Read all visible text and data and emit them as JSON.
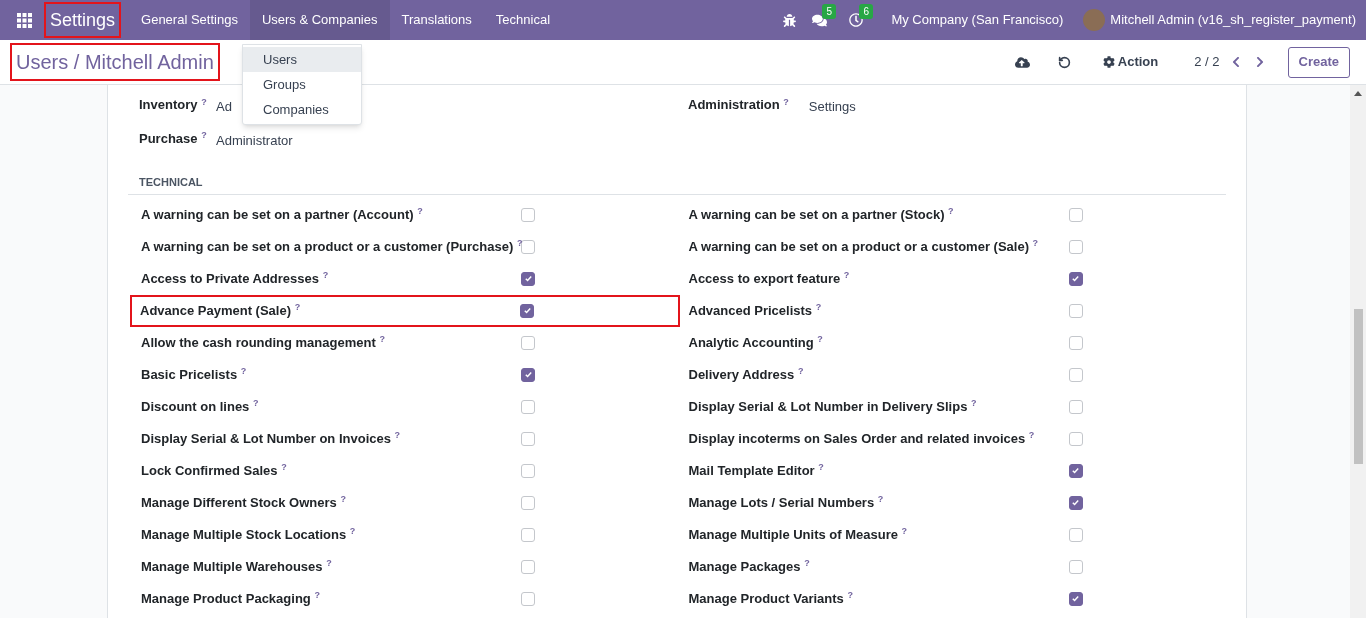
{
  "navbar": {
    "app": {
      "label": "Settings",
      "highlighted": true
    },
    "menus": [
      {
        "label": "General Settings",
        "selected": false
      },
      {
        "label": "Users & Companies",
        "selected": true
      },
      {
        "label": "Translations",
        "selected": false
      },
      {
        "label": "Technical",
        "selected": false
      }
    ],
    "messages_badge": "5",
    "activities_badge": "6",
    "company": "My Company (San Francisco)",
    "user": "Mitchell Admin (v16_sh_register_payment)"
  },
  "dropdown": [
    {
      "label": "Users",
      "selected": true
    },
    {
      "label": "Groups",
      "selected": false
    },
    {
      "label": "Companies",
      "selected": false
    }
  ],
  "breadcrumb": {
    "text": "Users / Mitchell Admin",
    "highlighted": true
  },
  "control_panel": {
    "action": "Action",
    "pager": "2 / 2",
    "create": "Create"
  },
  "access_rights": [
    {
      "label": "Inventory",
      "help": "?",
      "value": "Ad"
    },
    {
      "label": "Administration",
      "help": "?",
      "value": "Settings"
    },
    {
      "label": "Purchase",
      "help": "?",
      "value": "Administrator"
    }
  ],
  "section": "TECHNICAL",
  "settings": [
    {
      "label": "A warning can be set on a partner (Account)",
      "help": "?",
      "checked": false,
      "highlighted": false
    },
    {
      "label": "A warning can be set on a partner (Stock)",
      "help": "?",
      "checked": false,
      "highlighted": false
    },
    {
      "label": "A warning can be set on a product or a customer (Purchase)",
      "help": "?",
      "checked": false,
      "highlighted": false
    },
    {
      "label": "A warning can be set on a product or a customer (Sale)",
      "help": "?",
      "checked": false,
      "highlighted": false
    },
    {
      "label": "Access to Private Addresses",
      "help": "?",
      "checked": true,
      "highlighted": false
    },
    {
      "label": "Access to export feature",
      "help": "?",
      "checked": true,
      "highlighted": false
    },
    {
      "label": "Advance Payment (Sale)",
      "help": "?",
      "checked": true,
      "highlighted": true
    },
    {
      "label": "Advanced Pricelists",
      "help": "?",
      "checked": false,
      "highlighted": false
    },
    {
      "label": "Allow the cash rounding management",
      "help": "?",
      "checked": false,
      "highlighted": false
    },
    {
      "label": "Analytic Accounting",
      "help": "?",
      "checked": false,
      "highlighted": false
    },
    {
      "label": "Basic Pricelists",
      "help": "?",
      "checked": true,
      "highlighted": false
    },
    {
      "label": "Delivery Address",
      "help": "?",
      "checked": false,
      "highlighted": false
    },
    {
      "label": "Discount on lines",
      "help": "?",
      "checked": false,
      "highlighted": false
    },
    {
      "label": "Display Serial & Lot Number in Delivery Slips",
      "help": "?",
      "checked": false,
      "highlighted": false
    },
    {
      "label": "Display Serial & Lot Number on Invoices",
      "help": "?",
      "checked": false,
      "highlighted": false
    },
    {
      "label": "Display incoterms on Sales Order and related invoices",
      "help": "?",
      "checked": false,
      "highlighted": false
    },
    {
      "label": "Lock Confirmed Sales",
      "help": "?",
      "checked": false,
      "highlighted": false
    },
    {
      "label": "Mail Template Editor",
      "help": "?",
      "checked": true,
      "highlighted": false
    },
    {
      "label": "Manage Different Stock Owners",
      "help": "?",
      "checked": false,
      "highlighted": false
    },
    {
      "label": "Manage Lots / Serial Numbers",
      "help": "?",
      "checked": true,
      "highlighted": false
    },
    {
      "label": "Manage Multiple Stock Locations",
      "help": "?",
      "checked": false,
      "highlighted": false
    },
    {
      "label": "Manage Multiple Units of Measure",
      "help": "?",
      "checked": false,
      "highlighted": false
    },
    {
      "label": "Manage Multiple Warehouses",
      "help": "?",
      "checked": false,
      "highlighted": false
    },
    {
      "label": "Manage Packages",
      "help": "?",
      "checked": false,
      "highlighted": false
    },
    {
      "label": "Manage Product Packaging",
      "help": "?",
      "checked": false,
      "highlighted": false
    },
    {
      "label": "Manage Product Variants",
      "help": "?",
      "checked": true,
      "highlighted": false
    }
  ]
}
